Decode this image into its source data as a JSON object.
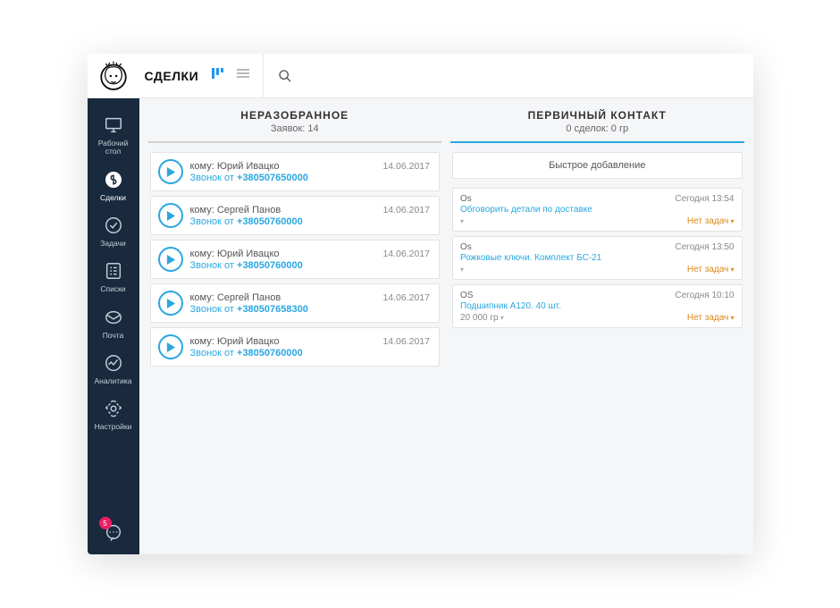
{
  "header": {
    "title": "СДЕЛКИ"
  },
  "sidebar": {
    "items": [
      {
        "label": "Рабочий\nстол",
        "icon": "screen"
      },
      {
        "label": "Сделки",
        "icon": "deal",
        "active": true
      },
      {
        "label": "Задачи",
        "icon": "check"
      },
      {
        "label": "Списки",
        "icon": "list"
      },
      {
        "label": "Почта",
        "icon": "mail"
      },
      {
        "label": "Аналитика",
        "icon": "analytics"
      },
      {
        "label": "Настройки",
        "icon": "settings"
      }
    ],
    "badge": "5"
  },
  "columns": {
    "unsorted": {
      "title": "НЕРАЗОБРАННОЕ",
      "sub": "Заявок: 14",
      "items": [
        {
          "to": "кому: Юрий Ивацко",
          "date": "14.06.2017",
          "label": "Звонок от ",
          "num": "+380507650000"
        },
        {
          "to": "кому: Сергей Панов",
          "date": "14.06.2017",
          "label": "Звонок от ",
          "num": "+38050760000"
        },
        {
          "to": "кому: Юрий Ивацко",
          "date": "14.06.2017",
          "label": "Звонок от ",
          "num": "+38050760000"
        },
        {
          "to": "кому: Сергей Панов",
          "date": "14.06.2017",
          "label": "Звонок от ",
          "num": "+380507658300"
        },
        {
          "to": "кому: Юрий Ивацко",
          "date": "14.06.2017",
          "label": "Звонок от ",
          "num": "+38050760000"
        }
      ]
    },
    "primary": {
      "title": "ПЕРВИЧНЫЙ КОНТАКТ",
      "sub": "0 сделок: 0 гр",
      "quick": "Быстрое добавление",
      "items": [
        {
          "auth": "Os",
          "time": "Сегодня 13:54",
          "title": "Обговорить детали по доставке",
          "sub": "",
          "task": "Нет задач"
        },
        {
          "auth": "Os",
          "time": "Сегодня 13:50",
          "title": "Рожковые ключи. Комплект БС-21",
          "sub": "",
          "task": "Нет задач"
        },
        {
          "auth": "OS",
          "time": "Сегодня 10:10",
          "title": "Подшипник А120. 40 шт.",
          "sub": "20 000 гр",
          "task": "Нет задач"
        }
      ]
    }
  }
}
